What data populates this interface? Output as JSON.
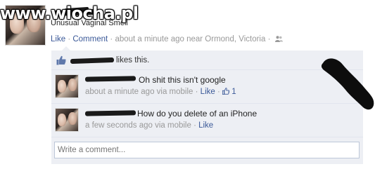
{
  "watermark": "www.wiocha.pl",
  "status": {
    "text": "Unusual Vaginal Smell",
    "actions": {
      "like": "Like",
      "comment": "Comment",
      "time": "about a minute ago near Ormond, Victoria"
    },
    "privacy_icon": "friends-icon"
  },
  "likes": {
    "icon": "thumbs-up-icon",
    "text": "likes this."
  },
  "comments": [
    {
      "text": "Oh shit this isn't google",
      "time": "about a minute ago via mobile",
      "like_label": "Like",
      "like_count": "1"
    },
    {
      "text": "How do you delete of an iPhone",
      "time": "a few seconds ago via mobile",
      "like_label": "Like"
    }
  ],
  "write_comment": {
    "placeholder": "Write a comment..."
  },
  "colors": {
    "link": "#3b5998",
    "feedback_bg": "#edeff4",
    "meta": "#999999"
  }
}
